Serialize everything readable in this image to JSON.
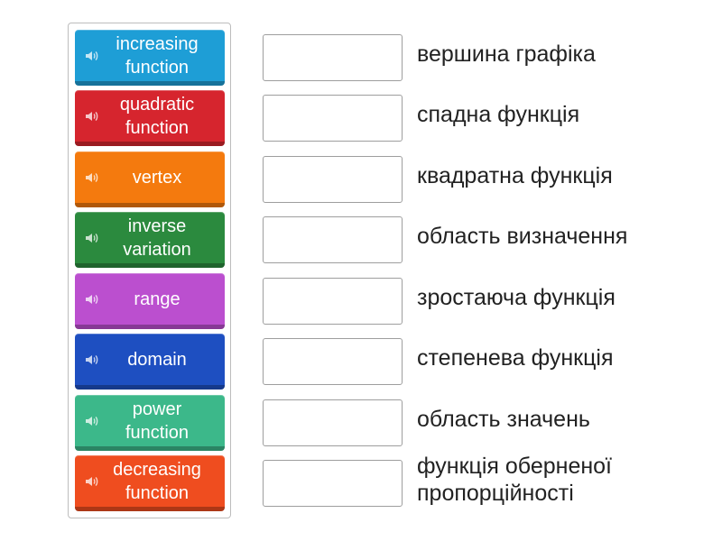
{
  "tiles": [
    {
      "label": "increasing function",
      "color": "#1e9ed6"
    },
    {
      "label": "quadratic function",
      "color": "#d6252e"
    },
    {
      "label": "vertex",
      "color": "#f47a0e"
    },
    {
      "label": "inverse variation",
      "color": "#2b8a3e"
    },
    {
      "label": "range",
      "color": "#bb4fcf"
    },
    {
      "label": "domain",
      "color": "#1e4fc1"
    },
    {
      "label": "power function",
      "color": "#3cb88a"
    },
    {
      "label": "decreasing function",
      "color": "#ef4d1f"
    }
  ],
  "definitions": [
    "вершина графіка",
    "спадна функція",
    "квадратна функція",
    "область визначення",
    "зростаюча функція",
    "степенева функція",
    "область значень",
    "функція оберненої пропорційності"
  ],
  "icons": {
    "tile_audio": "speaker-icon"
  }
}
